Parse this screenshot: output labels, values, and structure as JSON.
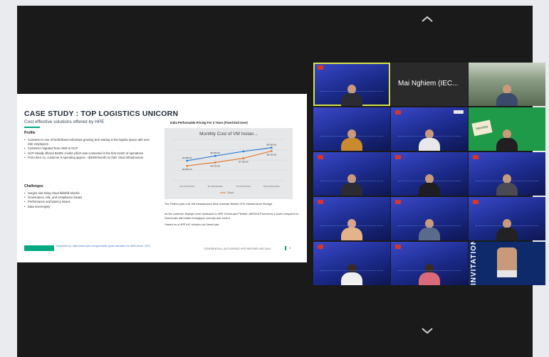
{
  "colors": {
    "page_bg": "#e9ebee",
    "meeting_bg": "#1a1a1a",
    "active_speaker_border": "#d6e34a",
    "hpe_green": "#01a982",
    "chart_line_blue": "#2b7fd6",
    "chart_line_orange": "#e07b35"
  },
  "shared_screen": {
    "title": "CASE STUDY : TOP LOGISTICS UNICORN",
    "subtitle": "Cost effective solutions offered by HPE",
    "profile": {
      "label": "Profile",
      "bullets": [
        "Customer is one of North/East IndoVEast growing tech startup in the logistic space with over 25K employees",
        "Customer migrated from AWS to GCP",
        "GCP initially offered $100K credits which was consumed in the first month of operations",
        "From then on, customer is spending approx. ~$200K/month on their cloud infrastructure"
      ]
    },
    "challenges": {
      "label": "Challenges",
      "bullets": [
        "Surges and rising cloud bills/bill shocks",
        "Governance, risk, and compliance issues",
        "Performance and latency issues",
        "Data sovereignty"
      ]
    },
    "chart_heading": "India Performable Pricing For 3 Years (Fixed End User)",
    "chart_note_1": "The Fintech paid a 3x VM Infrastructure drive overtake flexible CPU Infrastructure Storage",
    "chart_note_2": "As the customer deploys more workloads to HPE GreenLake Flexible, AWS/GCP becomes a lower compared to GreenLake with better throughput, security and control",
    "chart_note_3": "*based on a HPE IHC solution via GreenLake",
    "footer_text": "Supported by: https://www.hpe.com/greenlake-quote-calculator-for-AWS-Azure, 2023",
    "footer_right": "CONFIDENTIAL | AUTHORIZED HPE PARTNER USE ONLY",
    "page_number": "3"
  },
  "chart_data": {
    "type": "line",
    "title": "Monthly Cost of VM Instan...",
    "categories": [
      "25 INSTANCES",
      "50 INSTANCES",
      "75 INSTANCES",
      "100 INSTANCES"
    ],
    "series": [
      {
        "name": "Cloud",
        "values": [
          5800,
          7200,
          8500,
          9600
        ]
      },
      {
        "name": "",
        "values": [
          4300,
          5300,
          6500,
          8600
        ]
      }
    ],
    "data_labels": [
      {
        "series": 0,
        "index": 0,
        "text": "$4,985.00"
      },
      {
        "series": 0,
        "index": 1,
        "text": "$5,480.00"
      },
      {
        "series": 0,
        "index": 3,
        "text": "$9,940.00"
      },
      {
        "series": 1,
        "index": 0,
        "text": "$4,860.00"
      },
      {
        "series": 1,
        "index": 1,
        "text": "$4,790.00"
      },
      {
        "series": 1,
        "index": 2,
        "text": "$7,350.00"
      },
      {
        "series": 1,
        "index": 3,
        "text": "$8,190.00"
      }
    ],
    "legend": "Cloud",
    "ylim": [
      0,
      12000
    ],
    "grid": true,
    "legend_placement": "bottom"
  },
  "participants": [
    {
      "id": "p1",
      "name": "",
      "kind": "speaker",
      "active": true
    },
    {
      "id": "p2",
      "name": "Mai Nghiem (IEC...",
      "kind": "name-only"
    },
    {
      "id": "p3",
      "name": "",
      "kind": "room"
    },
    {
      "id": "p4",
      "name": "",
      "kind": "blue"
    },
    {
      "id": "p5",
      "name": "",
      "kind": "blue"
    },
    {
      "id": "p6",
      "name": "",
      "kind": "green"
    },
    {
      "id": "p7",
      "name": "",
      "kind": "blue"
    },
    {
      "id": "p8",
      "name": "",
      "kind": "blue"
    },
    {
      "id": "p9",
      "name": "",
      "kind": "blue"
    },
    {
      "id": "p10",
      "name": "",
      "kind": "blue"
    },
    {
      "id": "p11",
      "name": "",
      "kind": "blue"
    },
    {
      "id": "p12",
      "name": "",
      "kind": "blue"
    },
    {
      "id": "p13",
      "name": "",
      "kind": "blue"
    },
    {
      "id": "p14",
      "name": "",
      "kind": "blue"
    },
    {
      "id": "p15",
      "name": "",
      "kind": "invite"
    }
  ],
  "invite_tile_text": "INVITATION",
  "green_tile_sign": "Hennes"
}
